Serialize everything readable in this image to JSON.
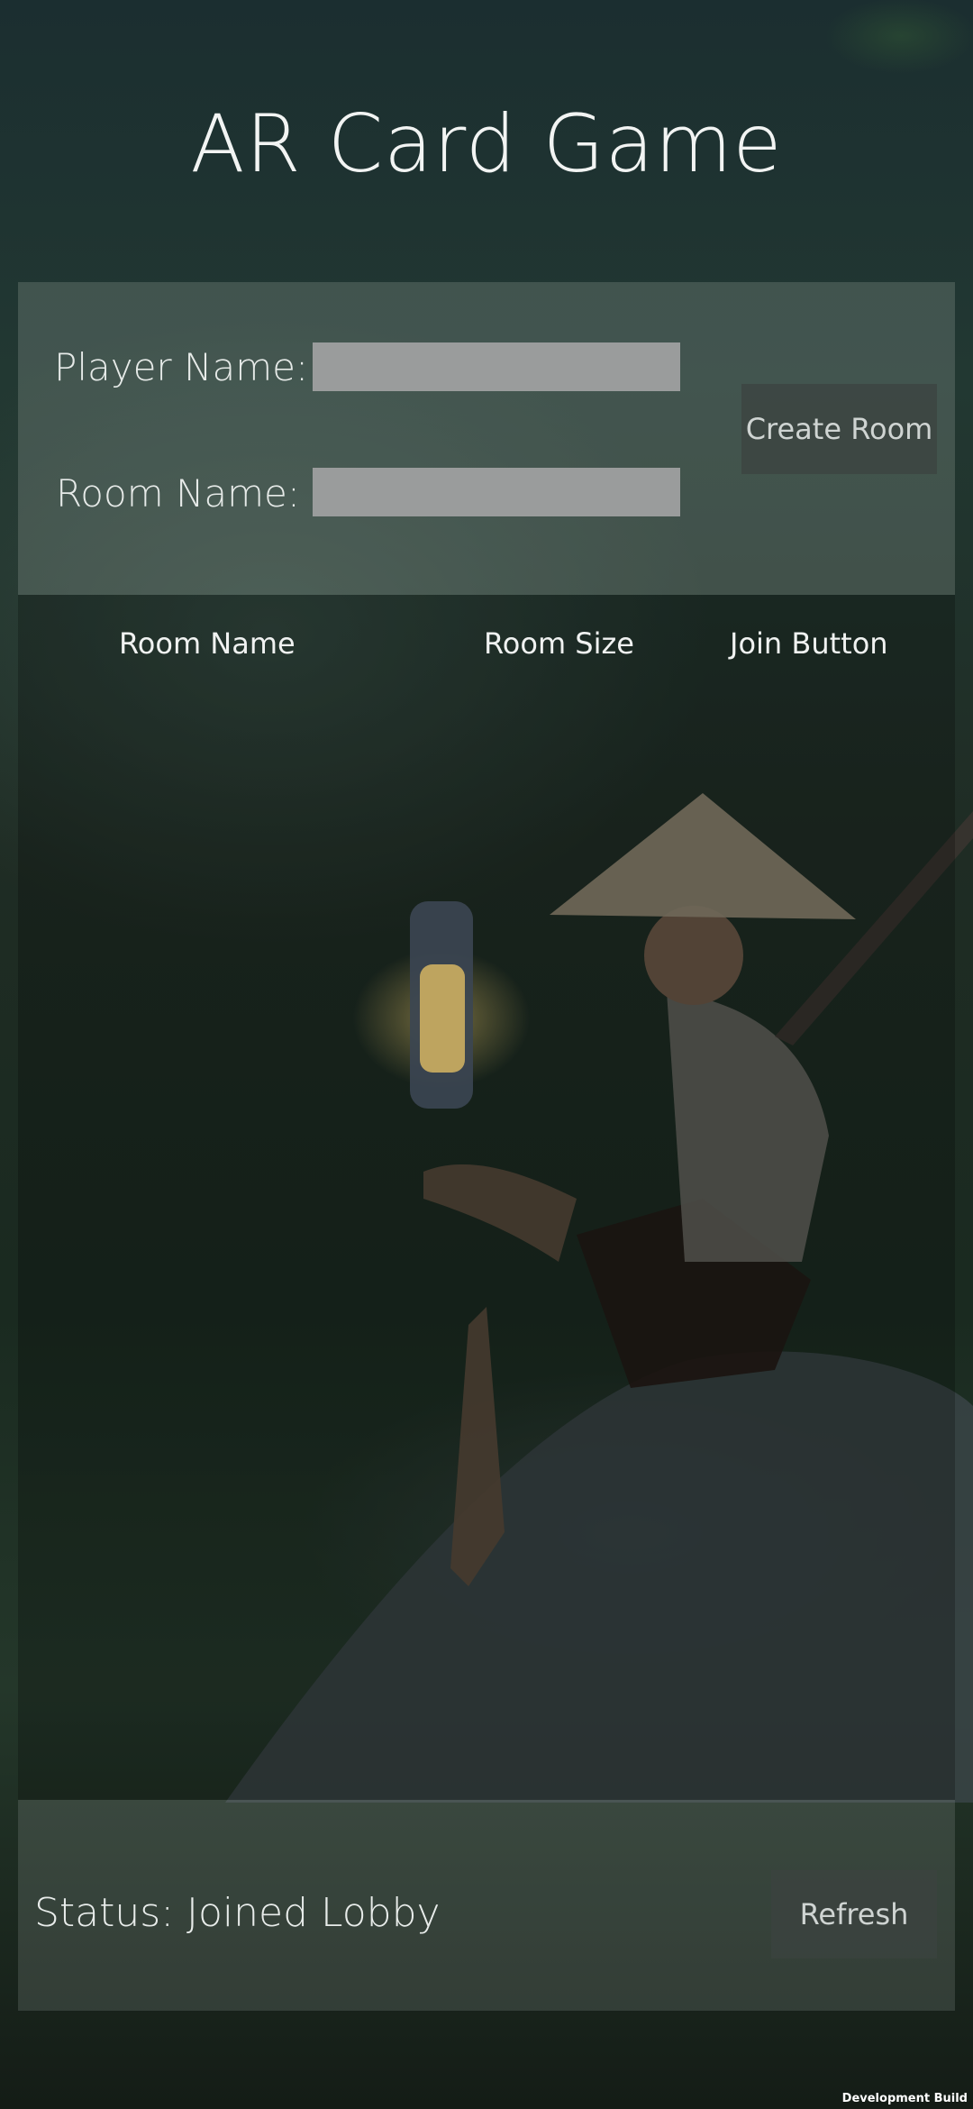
{
  "title": "AR Card Game",
  "form": {
    "player_label": "Player Name:",
    "player_value": "",
    "room_label": "Room Name:",
    "room_value": "",
    "create_button": "Create Room"
  },
  "room_list": {
    "headers": [
      "Room Name",
      "Room Size",
      "Join Button"
    ]
  },
  "footer": {
    "status": "Status: Joined Lobby",
    "refresh_button": "Refresh"
  },
  "build_label": "Development Build"
}
